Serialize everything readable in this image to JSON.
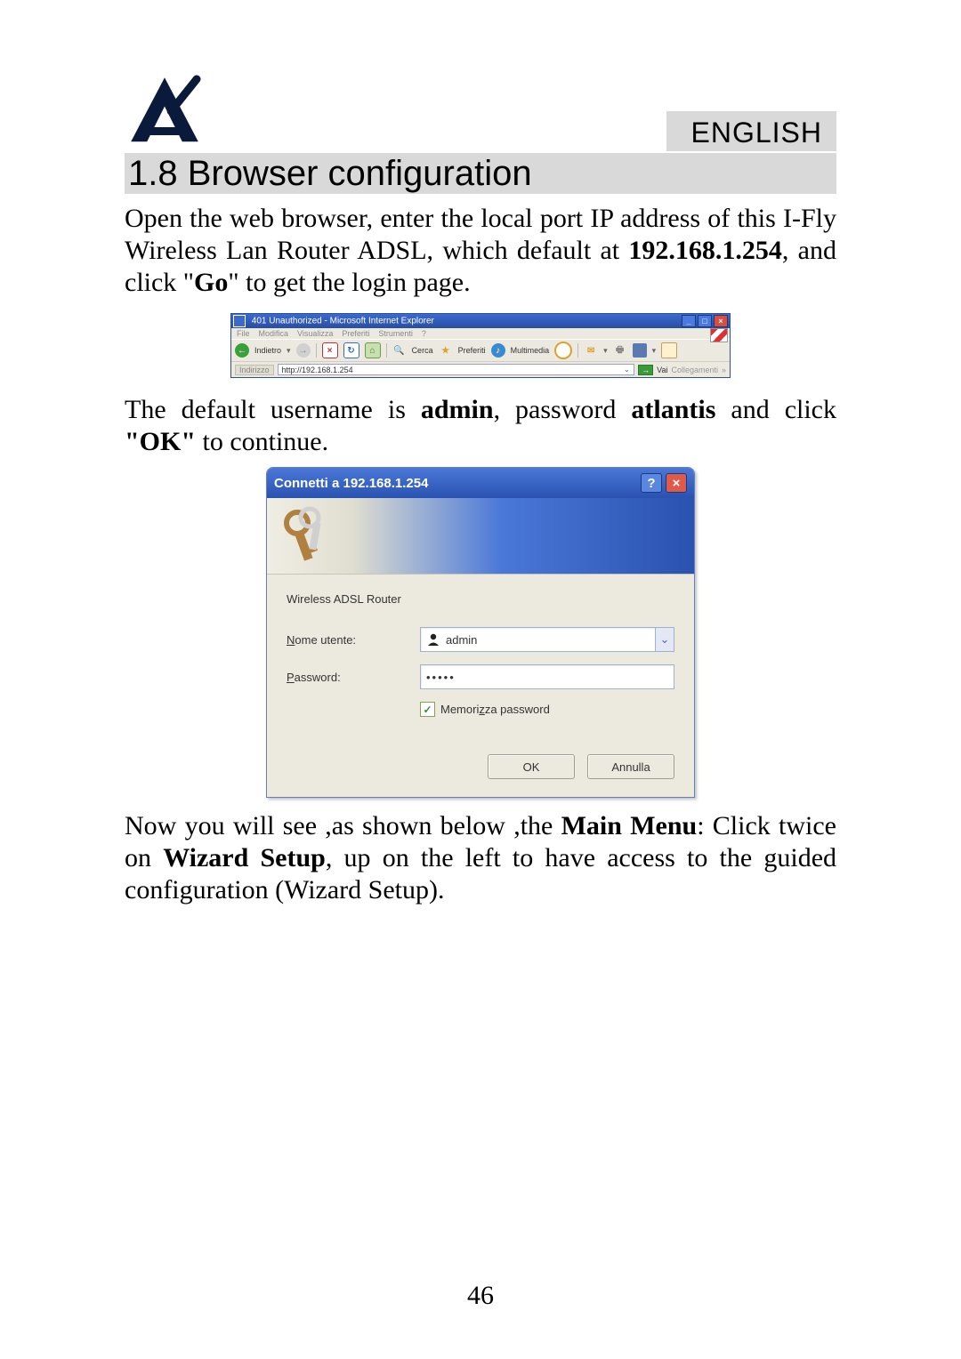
{
  "header": {
    "language": "ENGLISH",
    "section_title": "1.8 Browser configuration"
  },
  "paragraph1": {
    "pre": "Open the web browser, enter the local port IP address of this I-Fly Wireless Lan Router ADSL, which default at ",
    "ip_bold": "192.168.1.254",
    "mid1": ", and click \"",
    "go_bold": "Go",
    "post": "\" to get the login page."
  },
  "ie": {
    "title": "401 Unauthorized - Microsoft Internet Explorer",
    "menu": {
      "file": "File",
      "modifica": "Modifica",
      "visualizza": "Visualizza",
      "preferiti": "Preferiti",
      "strumenti": "Strumenti",
      "help": "?"
    },
    "toolbar": {
      "indietro": "Indietro",
      "cerca": "Cerca",
      "preferiti": "Preferiti",
      "multimedia": "Multimedia"
    },
    "address": {
      "label": "Indirizzo",
      "url": "http://192.168.1.254",
      "go": "Vai",
      "links": "Collegamenti"
    }
  },
  "paragraph2": {
    "pre": "The default username is ",
    "user_bold": "admin",
    "mid1": ", password ",
    "pass_bold": "atlantis",
    "mid2": " and click ",
    "ok_bold": "\"OK\"",
    "post": " to continue."
  },
  "login": {
    "title": "Connetti a 192.168.1.254",
    "realm": "Wireless ADSL Router",
    "username_label_pre": "N",
    "username_label_rest": "ome utente:",
    "username_value": "admin",
    "password_label_pre": "P",
    "password_label_rest": "assword:",
    "password_value": "•••••",
    "remember_pre": "Memori",
    "remember_ul": "z",
    "remember_post": "za password",
    "ok": "OK",
    "cancel": "Annulla"
  },
  "paragraph3": {
    "pre": "Now you will see ,as shown below ,the ",
    "mm_bold": "Main Menu",
    "mid1": ": Click twice on ",
    "ws_bold": "Wizard Setup",
    "post": ", up on the left to have access to the guided configuration (Wizard Setup)."
  },
  "page_number": "46"
}
